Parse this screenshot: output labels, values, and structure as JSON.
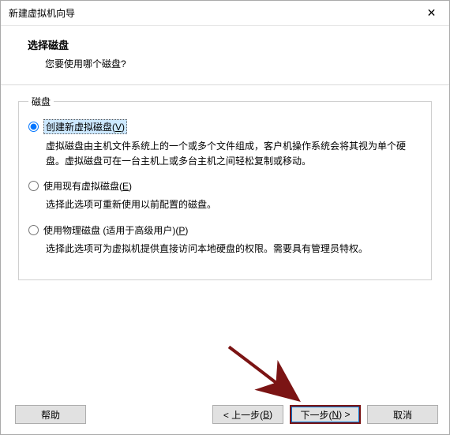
{
  "window": {
    "title": "新建虚拟机向导"
  },
  "header": {
    "title": "选择磁盘",
    "subtitle": "您要使用哪个磁盘?"
  },
  "fieldset": {
    "legend": "磁盘"
  },
  "options": {
    "create": {
      "label_pre": "创建新虚拟磁盘(",
      "key": "V",
      "label_post": ")",
      "desc": "虚拟磁盘由主机文件系统上的一个或多个文件组成，客户机操作系统会将其视为单个硬盘。虚拟磁盘可在一台主机上或多台主机之间轻松复制或移动。"
    },
    "existing": {
      "label_pre": "使用现有虚拟磁盘(",
      "key": "E",
      "label_post": ")",
      "desc": "选择此选项可重新使用以前配置的磁盘。"
    },
    "physical": {
      "label_pre": "使用物理磁盘 (适用于高级用户)(",
      "key": "P",
      "label_post": ")",
      "desc": "选择此选项可为虚拟机提供直接访问本地硬盘的权限。需要具有管理员特权。"
    }
  },
  "buttons": {
    "help": "帮助",
    "back_pre": "< 上一步(",
    "back_key": "B",
    "back_post": ")",
    "next_pre": "下一步(",
    "next_key": "N",
    "next_post": ") >",
    "cancel": "取消"
  }
}
